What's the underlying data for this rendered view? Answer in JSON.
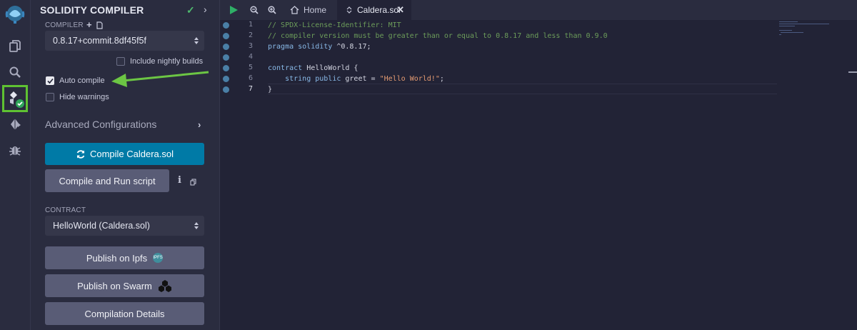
{
  "panel": {
    "title": "SOLIDITY COMPILER",
    "compiler_label": "COMPILER",
    "compiler_version": "0.8.17+commit.8df45f5f",
    "nightly_label": "Include nightly builds",
    "nightly_checked": false,
    "auto_compile_label": "Auto compile",
    "auto_compile_checked": true,
    "hide_warnings_label": "Hide warnings",
    "hide_warnings_checked": false,
    "advanced_label": "Advanced Configurations",
    "compile_button": "Compile Caldera.sol",
    "run_script_button": "Compile and Run script",
    "contract_label": "CONTRACT",
    "contract_value": "HelloWorld (Caldera.sol)",
    "publish_ipfs_button": "Publish on Ipfs",
    "ipfs_badge": "IPFS",
    "publish_swarm_button": "Publish on Swarm",
    "details_button": "Compilation Details"
  },
  "tabs": {
    "home": "Home",
    "file": "Caldera.sol"
  },
  "editor": {
    "line_numbers": [
      "1",
      "2",
      "3",
      "4",
      "5",
      "6",
      "7"
    ],
    "current_line": 7,
    "lines": {
      "l1": "// SPDX-License-Identifier: MIT",
      "l2": "// compiler version must be greater than or equal to 0.8.17 and less than 0.9.0",
      "l3_kw": "pragma solidity",
      "l3_rest": " ^0.8.17;",
      "l4": "",
      "l5_kw": "contract",
      "l5_rest": " HelloWorld {",
      "l6_indent": "    ",
      "l6_kw": "string public",
      "l6_mid": " greet = ",
      "l6_str": "\"Hello World!\"",
      "l6_end": ";",
      "l7": "}"
    }
  },
  "icons": {
    "rail": [
      "remix-logo-icon",
      "file-explorer-icon",
      "search-icon",
      "solidity-compiler-icon",
      "deploy-run-icon",
      "debugger-icon"
    ],
    "tabbar": [
      "run-icon",
      "zoom-out-icon",
      "zoom-in-icon",
      "home-icon",
      "solidity-file-icon",
      "close-icon"
    ]
  },
  "colors": {
    "accent": "#007aa6",
    "highlight_green": "#5fc232",
    "success_check": "#4fba6f"
  }
}
